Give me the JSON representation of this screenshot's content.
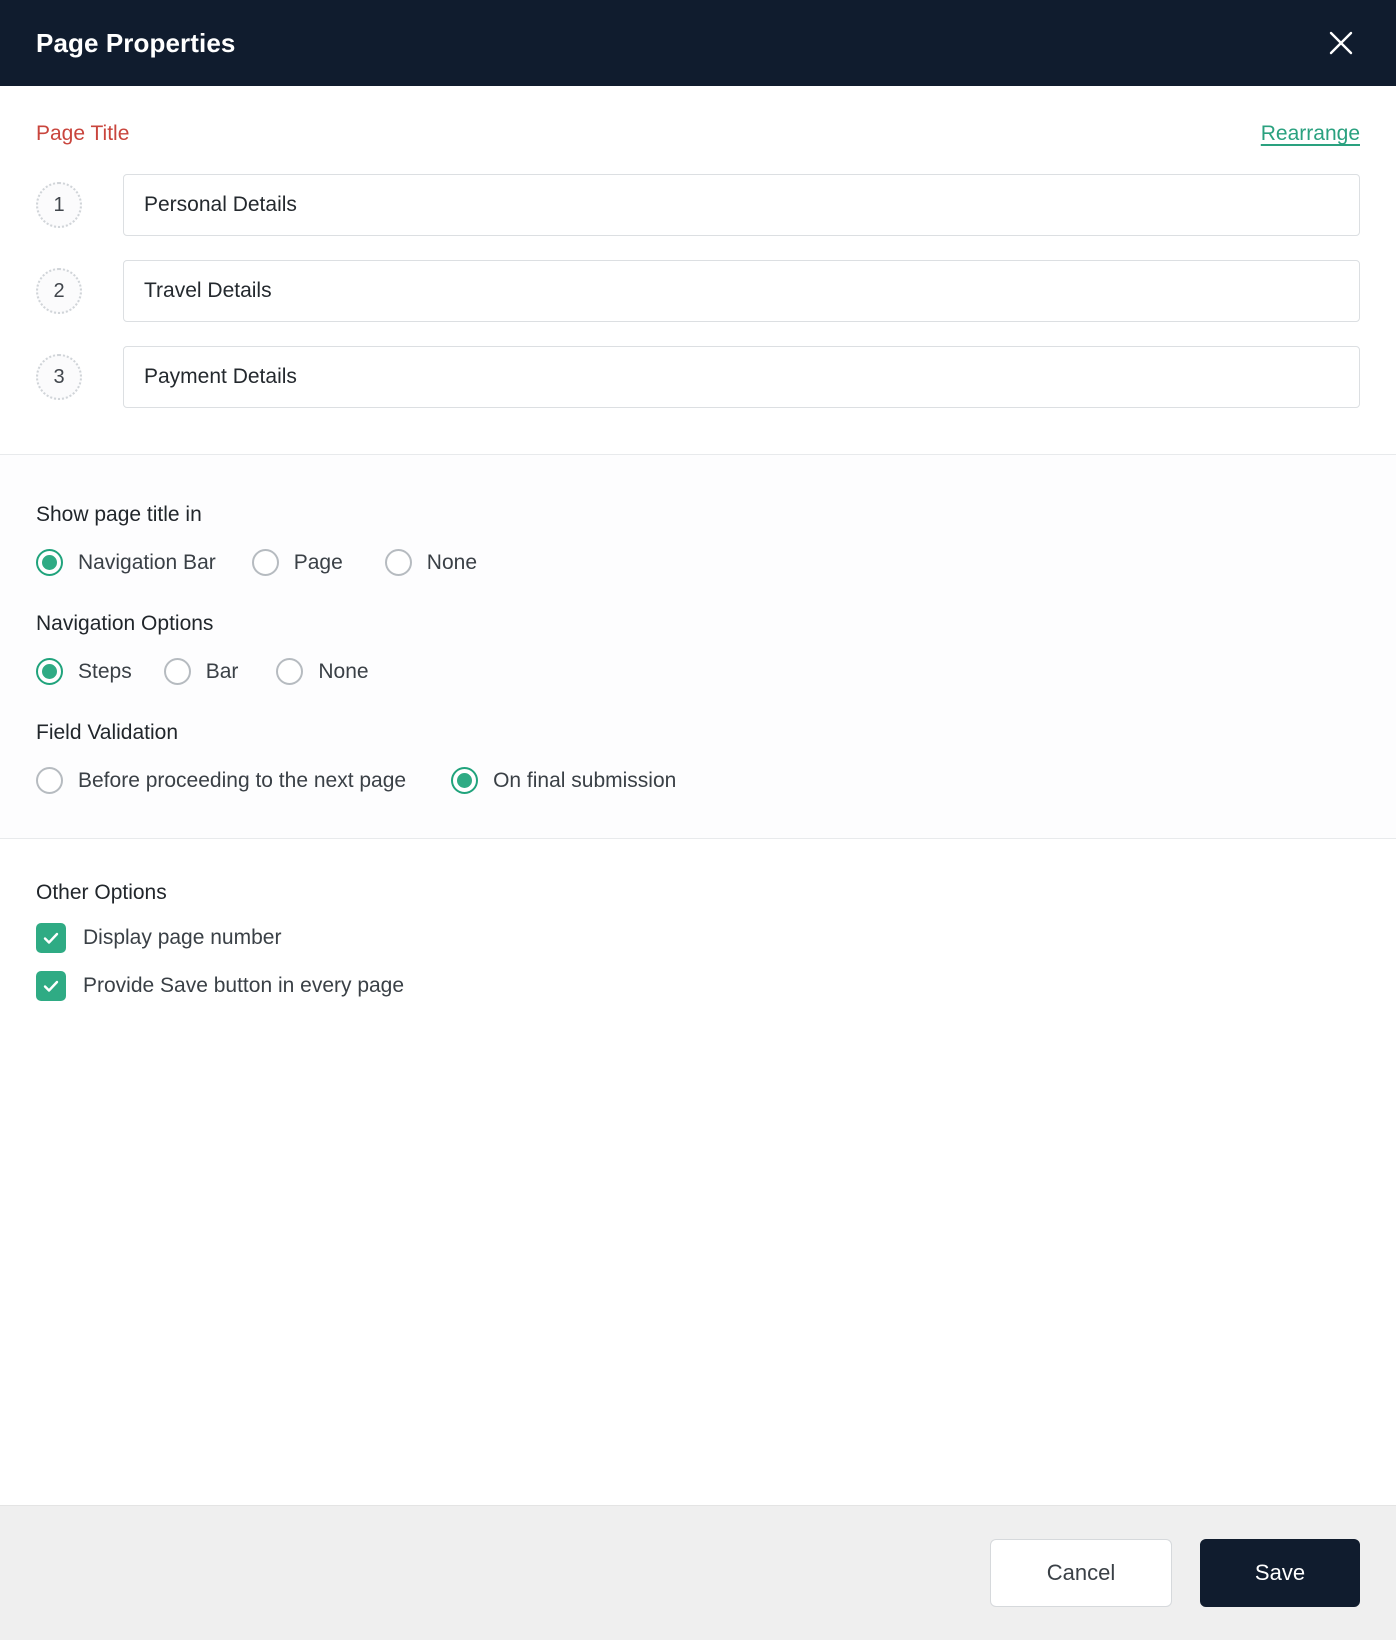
{
  "header": {
    "title": "Page Properties",
    "close_icon": "close-icon"
  },
  "titles": {
    "label": "Page Title",
    "rearrange_label": "Rearrange",
    "rows": [
      {
        "number": "1",
        "value": "Personal Details"
      },
      {
        "number": "2",
        "value": "Travel Details"
      },
      {
        "number": "3",
        "value": "Payment Details"
      }
    ]
  },
  "show_page_title": {
    "label": "Show page title in",
    "options": [
      {
        "label": "Navigation Bar",
        "selected": true
      },
      {
        "label": "Page",
        "selected": false
      },
      {
        "label": "None",
        "selected": false
      }
    ]
  },
  "navigation_options": {
    "label": "Navigation Options",
    "options": [
      {
        "label": "Steps",
        "selected": true
      },
      {
        "label": "Bar",
        "selected": false
      },
      {
        "label": "None",
        "selected": false
      }
    ]
  },
  "field_validation": {
    "label": "Field Validation",
    "options": [
      {
        "label": "Before proceeding to the next page",
        "selected": false
      },
      {
        "label": "On final submission",
        "selected": true
      }
    ]
  },
  "other_options": {
    "label": "Other Options",
    "checkboxes": [
      {
        "label": "Display page number",
        "checked": true
      },
      {
        "label": "Provide Save button in every page",
        "checked": true
      }
    ]
  },
  "footer": {
    "cancel_label": "Cancel",
    "save_label": "Save"
  },
  "colors": {
    "header_bg": "#101c2e",
    "accent_green": "#2fab84",
    "link_green": "#2aa17f",
    "required_red": "#c9453d",
    "footer_bg": "#efefef"
  }
}
